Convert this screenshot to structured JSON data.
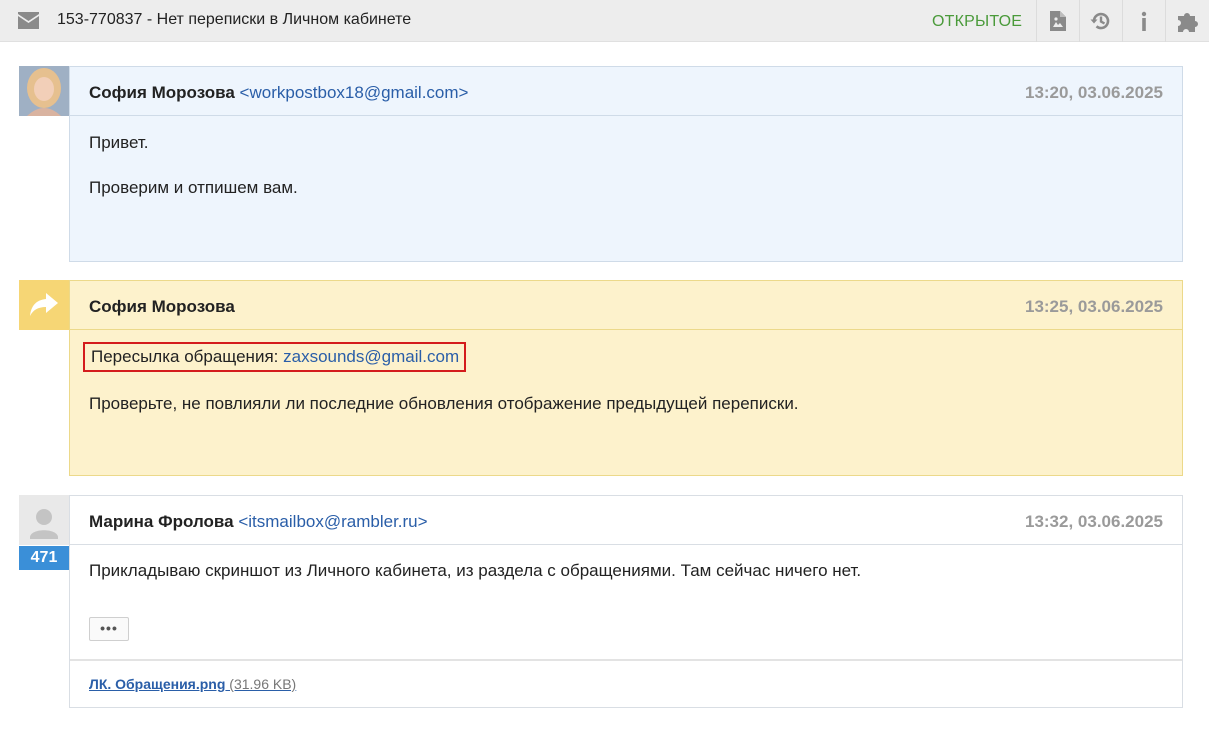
{
  "header": {
    "title": "153-770837 - Нет переписки в Личном кабинете",
    "status": "ОТКРЫТОЕ",
    "icons": [
      "mail-icon",
      "pdf-icon",
      "history-icon",
      "info-icon",
      "plugin-icon"
    ]
  },
  "messages": [
    {
      "sender": "София Морозова",
      "email": "<workpostbox18@gmail.com>",
      "date": "13:20, 03.06.2025",
      "lines": [
        "Привет.",
        "Проверим и отпишем вам."
      ]
    },
    {
      "sender": "София Морозова",
      "date": "13:25, 03.06.2025",
      "forward_label": "Пересылка обращения: ",
      "forward_email": "zaxsounds@gmail.com",
      "lines": [
        "Проверьте, не повлияли ли последние обновления отображение предыдущей переписки."
      ]
    },
    {
      "sender": "Марина Фролова",
      "email": "<itsmailbox@rambler.ru>",
      "date": "13:32, 03.06.2025",
      "badge": "471",
      "lines": [
        "Прикладываю скриншот из Личного кабинета, из раздела с обращениями. Там сейчас ничего нет."
      ],
      "more_label": "•••",
      "attachment": {
        "name": "ЛК. Обращения.png",
        "size": " (31.96 KB)"
      }
    }
  ],
  "colors": {
    "status": "#4a9a3a",
    "link": "#2a5ea8",
    "highlight_border": "#d41c1c",
    "note_bg": "#fdf2cc",
    "client_bg": "#eef5fd",
    "badge_bg": "#3a8fd8"
  }
}
